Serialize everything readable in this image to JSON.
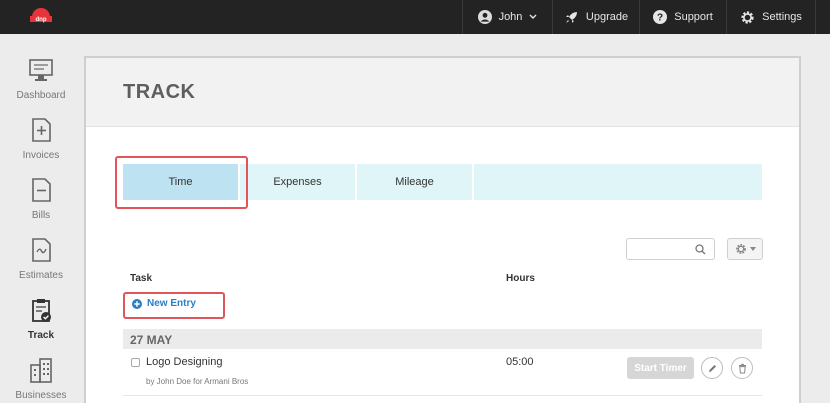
{
  "topbar": {
    "logo_text": "dnp",
    "user_label": "John",
    "upgrade_label": "Upgrade",
    "support_label": "Support",
    "settings_label": "Settings"
  },
  "sidebar": {
    "items": [
      {
        "label": "Dashboard",
        "icon": "monitor-icon"
      },
      {
        "label": "Invoices",
        "icon": "document-plus-icon"
      },
      {
        "label": "Bills",
        "icon": "document-minus-icon"
      },
      {
        "label": "Estimates",
        "icon": "document-wave-icon"
      },
      {
        "label": "Track",
        "icon": "clipboard-check-icon",
        "active": true
      },
      {
        "label": "Businesses",
        "icon": "buildings-icon"
      }
    ]
  },
  "main": {
    "title": "TRACK",
    "tabs": [
      {
        "label": "Time",
        "active": true
      },
      {
        "label": "Expenses"
      },
      {
        "label": "Mileage"
      }
    ],
    "search_placeholder": "",
    "columns": {
      "task": "Task",
      "hours": "Hours"
    },
    "new_entry_label": "New Entry",
    "groups": [
      {
        "date": "27 MAY",
        "entries": [
          {
            "task": "Logo Designing",
            "sub": "by John Doe for Armani Bros",
            "hours": "05:00",
            "action": "Start Timer"
          }
        ]
      }
    ]
  },
  "colors": {
    "topbar_bg": "#232323",
    "tab_active_bg": "#bde3f2",
    "tab_bg": "#dff5f7",
    "link_blue": "#2a7fc2",
    "highlight_red": "#e0555a"
  }
}
